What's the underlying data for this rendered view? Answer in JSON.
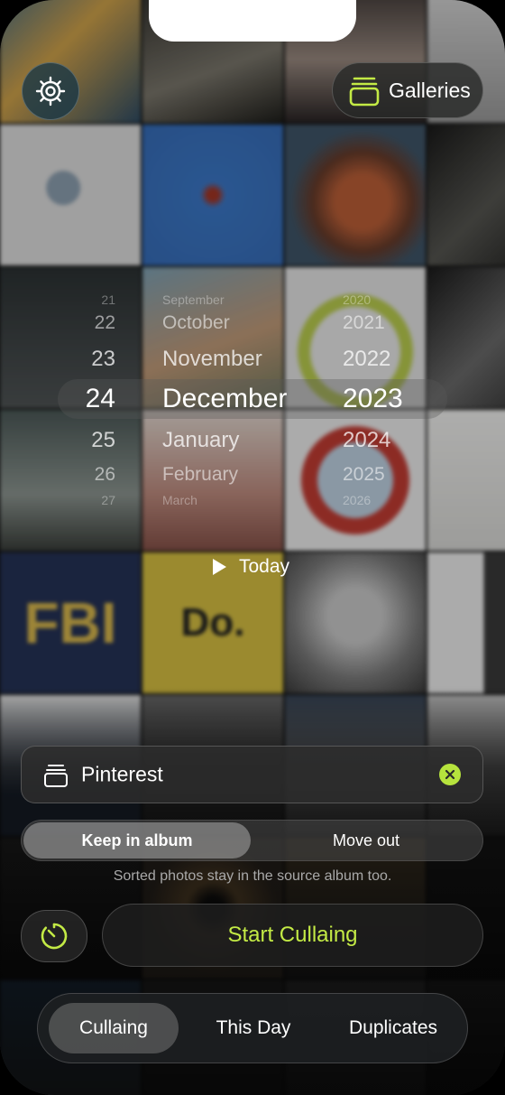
{
  "header": {
    "settings_icon": "gear-icon",
    "galleries_label": "Galleries",
    "galleries_icon": "stack-icon"
  },
  "date_picker": {
    "days": [
      "21",
      "22",
      "23",
      "24",
      "25",
      "26",
      "27"
    ],
    "months": [
      "September",
      "October",
      "November",
      "December",
      "January",
      "February",
      "March"
    ],
    "years": [
      "2020",
      "2021",
      "2022",
      "2023",
      "2024",
      "2025",
      "2026"
    ],
    "selected": {
      "day": "24",
      "month": "December",
      "year": "2023"
    }
  },
  "today_label": "Today",
  "album": {
    "name": "Pinterest",
    "icon": "album-stack-icon"
  },
  "mode": {
    "options": [
      "Keep in album",
      "Move out"
    ],
    "selected": "Keep in album",
    "hint": "Sorted photos stay in the source album too."
  },
  "start_button_label": "Start Cullaing",
  "tabs": [
    {
      "label": "Cullaing",
      "active": true
    },
    {
      "label": "This Day",
      "active": false
    },
    {
      "label": "Duplicates",
      "active": false
    }
  ],
  "background_tiles": [
    "FBI",
    "Do."
  ],
  "colors": {
    "accent": "#c3ea45",
    "clear_badge": "#b6e33d"
  }
}
